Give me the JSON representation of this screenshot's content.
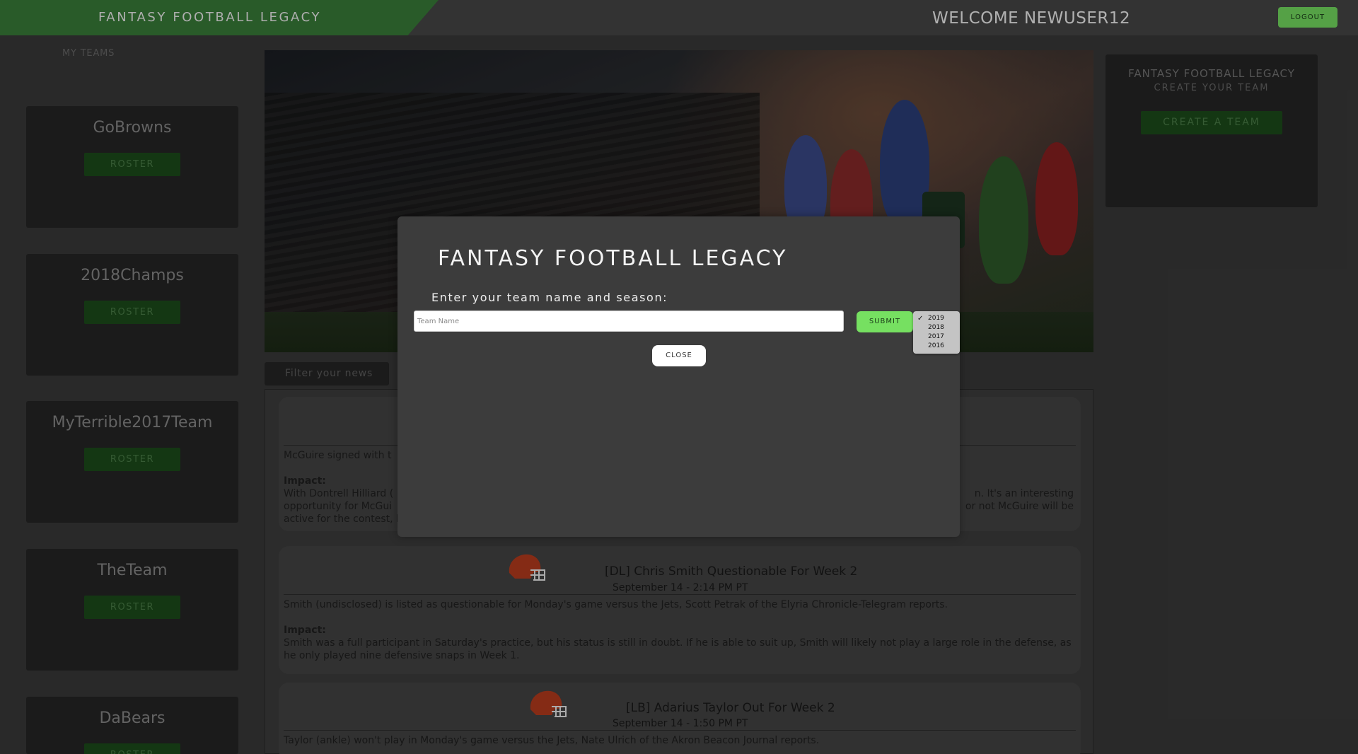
{
  "header": {
    "brand": "FANTASY FOOTBALL LEGACY",
    "welcome": "WELCOME NEWUSER12",
    "logout_label": "LOGOUT"
  },
  "sidebar": {
    "heading": "MY TEAMS",
    "teams": [
      {
        "name": "GoBrowns",
        "roster_label": "ROSTER"
      },
      {
        "name": "2018Champs",
        "roster_label": "ROSTER"
      },
      {
        "name": "MyTerrible2017Team",
        "roster_label": "ROSTER"
      },
      {
        "name": "TheTeam",
        "roster_label": "ROSTER"
      },
      {
        "name": "DaBears",
        "roster_label": "ROSTER"
      }
    ]
  },
  "create_card": {
    "title": "FANTASY FOOTBALL LEGACY",
    "subtitle": "CREATE YOUR TEAM",
    "button_label": "CREATE A TEAM"
  },
  "news": {
    "filter_placeholder": "Filter your news",
    "items": [
      {
        "title": "",
        "date": "",
        "body_first": "McGuire signed with t",
        "impact_label": "Impact:",
        "impact_left": "With Dontrell Hilliard (",
        "impact_left_2": "opportunity for McGui",
        "impact_left_3": "active for the contest, l",
        "impact_right": "n. It's an interesting",
        "impact_right_2": "or not McGuire will be"
      },
      {
        "title": "[DL] Chris Smith Questionable For Week 2",
        "date": "September 14 - 2:14 PM PT",
        "body": "Smith (undisclosed) is listed as questionable for Monday's game versus the Jets, Scott Petrak of the Elyria Chronicle-Telegram reports.",
        "impact_label": "Impact:",
        "impact": "Smith was a full participant in Saturday's practice, but his status is still in doubt. If he is able to suit up, Smith will likely not play a large role in the defense, as he only played nine defensive snaps in Week 1."
      },
      {
        "title": "[LB] Adarius Taylor Out For Week 2",
        "date": "September 14 - 1:50 PM PT",
        "body": "Taylor (ankle) won't play in Monday's game versus the Jets, Nate Ulrich of the Akron Beacon Journal reports."
      }
    ]
  },
  "modal": {
    "title": "FANTASY FOOTBALL LEGACY",
    "prompt": "Enter your team name and season:",
    "team_name_placeholder": "Team Name",
    "team_name_value": "",
    "submit_label": "SUBMIT",
    "season_options": [
      "2019",
      "2018",
      "2017",
      "2016"
    ],
    "selected_season": "2019",
    "close_label": "CLOSE"
  },
  "colors": {
    "brand_green": "#3a7f39",
    "accent_green": "#76e061",
    "dark_card": "#262626"
  }
}
